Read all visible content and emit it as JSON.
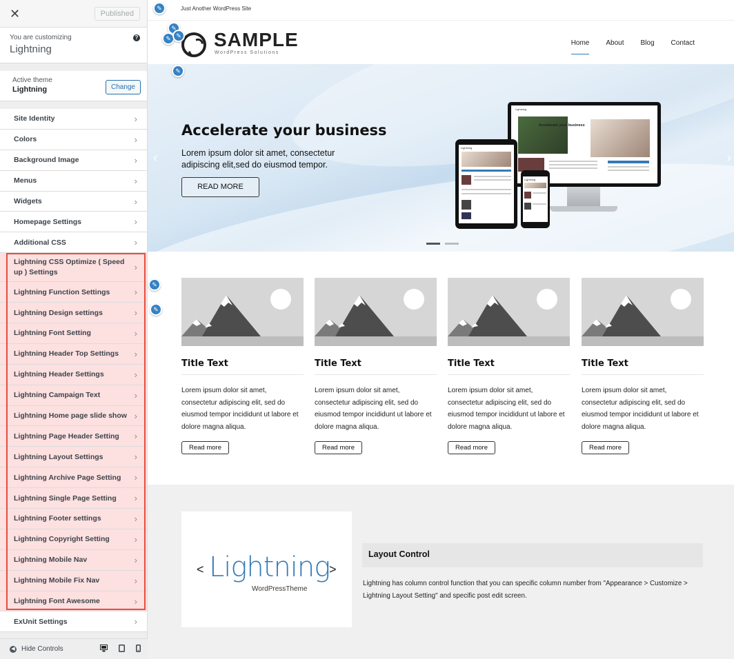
{
  "sidebar": {
    "close_icon": "close-icon",
    "published_label": "Published",
    "customizing_label": "You are customizing",
    "customizing_theme": "Lightning",
    "active_theme_label": "Active theme",
    "active_theme_name": "Lightning",
    "change_label": "Change",
    "items": [
      {
        "label": "Site Identity",
        "highlighted": false
      },
      {
        "label": "Colors",
        "highlighted": false
      },
      {
        "label": "Background Image",
        "highlighted": false
      },
      {
        "label": "Menus",
        "highlighted": false
      },
      {
        "label": "Widgets",
        "highlighted": false
      },
      {
        "label": "Homepage Settings",
        "highlighted": false
      },
      {
        "label": "Additional CSS",
        "highlighted": false
      },
      {
        "label": "Lightning CSS Optimize ( Speed up ) Settings",
        "highlighted": true
      },
      {
        "label": "Lightning Function Settings",
        "highlighted": true
      },
      {
        "label": "Lightning Design settings",
        "highlighted": true
      },
      {
        "label": "Lightning Font Setting",
        "highlighted": true
      },
      {
        "label": "Lightning Header Top Settings",
        "highlighted": true
      },
      {
        "label": "Lightning Header Settings",
        "highlighted": true
      },
      {
        "label": "Lightning Campaign Text",
        "highlighted": true
      },
      {
        "label": "Lightning Home page slide show",
        "highlighted": true
      },
      {
        "label": "Lightning Page Header Setting",
        "highlighted": true
      },
      {
        "label": "Lightning Layout Settings",
        "highlighted": true
      },
      {
        "label": "Lightning Archive Page Setting",
        "highlighted": true
      },
      {
        "label": "Lightning Single Page Setting",
        "highlighted": true
      },
      {
        "label": "Lightning Footer settings",
        "highlighted": true
      },
      {
        "label": "Lightning Copyright Setting",
        "highlighted": true
      },
      {
        "label": "Lightning Mobile Nav",
        "highlighted": true
      },
      {
        "label": "Lightning Mobile Fix Nav",
        "highlighted": true
      },
      {
        "label": "Lightning Font Awesome",
        "highlighted": true
      },
      {
        "label": "ExUnit Settings",
        "highlighted": false
      }
    ],
    "hide_controls_label": "Hide Controls",
    "highlight_color": "#e74c3c"
  },
  "preview": {
    "site_tagline": "Just Another WordPress Site",
    "logo_text": "SAMPLE",
    "logo_sub": "WordPress Solutions",
    "nav": [
      "Home",
      "About",
      "Blog",
      "Contact"
    ],
    "hero": {
      "title": "Accelerate your business",
      "text": "Lorem ipsum dolor sit amet, consectetur adipiscing elit,sed do eiusmod tempor.",
      "button": "READ MORE"
    },
    "device_screen": {
      "monitor_header": "Lightning",
      "monitor_title": "Accelerate your business",
      "tablet_header": "Lightning",
      "phone_header": "Lightning"
    },
    "cards": [
      {
        "title": "Title Text",
        "text": "Lorem ipsum dolor sit amet, consectetur adipiscing elit, sed do eiusmod tempor incididunt ut labore et dolore magna aliqua.",
        "button": "Read more"
      },
      {
        "title": "Title Text",
        "text": "Lorem ipsum dolor sit amet, consectetur adipiscing elit, sed do eiusmod tempor incididunt ut labore et dolore magna aliqua.",
        "button": "Read more"
      },
      {
        "title": "Title Text",
        "text": "Lorem ipsum dolor sit amet, consectetur adipiscing elit, sed do eiusmod tempor incididunt ut labore et dolore magna aliqua.",
        "button": "Read more"
      },
      {
        "title": "Title Text",
        "text": "Lorem ipsum dolor sit amet, consectetur adipiscing elit, sed do eiusmod tempor incididunt ut labore et dolore magna aliqua.",
        "button": "Read more"
      }
    ],
    "lightning_logo": {
      "lt": "<",
      "word": "Lightning",
      "gt": ">",
      "sub": "WordPressTheme"
    },
    "layout_control": {
      "title": "Layout Control",
      "text": "Lightning has column control function that you can specific column number from \"Appearance > Customize > Lightning Layout Setting\" and specific post edit screen."
    },
    "accent_color": "#337ab7",
    "pencil_color": "#3582c4"
  }
}
